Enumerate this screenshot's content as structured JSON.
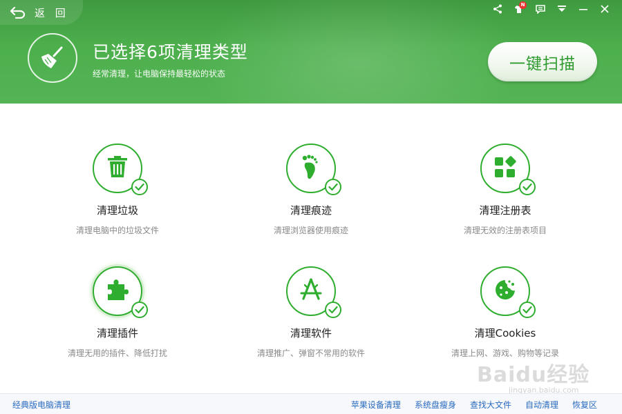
{
  "header": {
    "back_label": "返 回",
    "title": "已选择6项清理类型",
    "subtitle": "经常清理，让电脑保持最轻松的状态",
    "scan_button": "一键扫描",
    "top_icons": [
      "share-icon",
      "skin-icon",
      "feedback-icon",
      "menu-icon",
      "minimize-icon",
      "close-icon"
    ],
    "badge": "N"
  },
  "items": [
    {
      "name": "清理垃圾",
      "desc": "清理电脑中的垃圾文件",
      "icon": "trash-icon"
    },
    {
      "name": "清理痕迹",
      "desc": "清理浏览器使用痕迹",
      "icon": "footprint-icon"
    },
    {
      "name": "清理注册表",
      "desc": "清理无效的注册表项目",
      "icon": "registry-icon"
    },
    {
      "name": "清理插件",
      "desc": "清理无用的插件、降低打扰",
      "icon": "puzzle-icon"
    },
    {
      "name": "清理软件",
      "desc": "清理推广、弹窗不常用的软件",
      "icon": "appstore-icon"
    },
    {
      "name": "清理Cookies",
      "desc": "清理上网、游戏、购物等记录",
      "icon": "cookie-icon"
    }
  ],
  "footer": {
    "classic": "经典版电脑清理",
    "links": [
      "苹果设备清理",
      "系统盘瘦身",
      "查找大文件",
      "自动清理",
      "恢复区"
    ]
  },
  "watermark": {
    "main": "Baidu经验",
    "sub": "jingyan.baidu.com"
  },
  "colors": {
    "brand_green": "#2ead2e",
    "header_green": "#4caf4c",
    "link_blue": "#2a6bbf"
  }
}
